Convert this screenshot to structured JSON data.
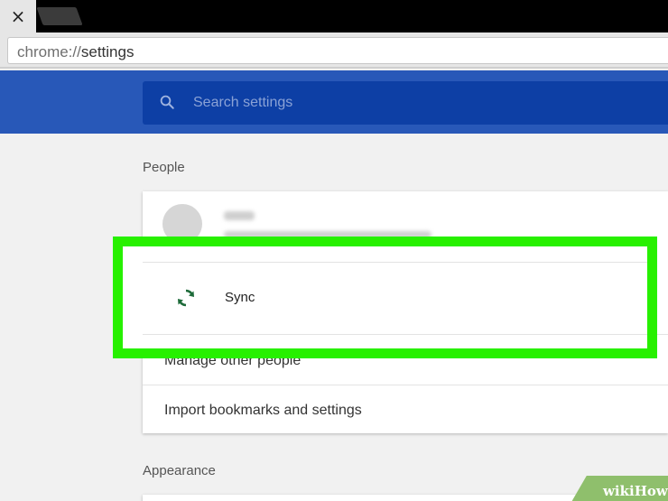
{
  "browser": {
    "tab_close_glyph": "×",
    "url_scheme": "chrome://",
    "url_path": "settings"
  },
  "settings": {
    "search_placeholder": "Search settings",
    "section_people": "People",
    "sync_label": "Sync",
    "manage_people": "Manage other people",
    "import_label": "Import bookmarks and settings",
    "section_appearance": "Appearance"
  },
  "icons": {
    "search": "search-icon",
    "sync": "sync-icon",
    "avatar": "person-avatar"
  },
  "colors": {
    "header_blue": "#2858b8",
    "search_blue": "#0d3fa5",
    "highlight_green": "#27f000",
    "sync_icon_green": "#1e6b3a"
  },
  "watermark": {
    "prefix": "wiki",
    "suffix": "How"
  }
}
